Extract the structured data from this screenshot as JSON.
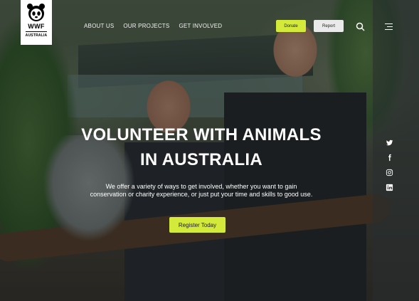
{
  "brand": {
    "logo_text": "WWF",
    "logo_subtext": "AUSTRALIA",
    "icon": "panda-icon"
  },
  "nav": {
    "items": [
      {
        "label": "ABOUT US"
      },
      {
        "label": "OUR PROJECTS"
      },
      {
        "label": "GET INVOLVED"
      }
    ]
  },
  "header_actions": {
    "donate_label": "Donate",
    "report_label": "Report",
    "search_icon": "search-icon",
    "menu_icon": "hamburger-menu-icon"
  },
  "hero": {
    "title_line1": "VOLUNTEER WITH ANIMALS",
    "title_line2": "IN AUSTRALIA",
    "subtitle_line1": "We offer a variety of ways to get involved, whether you want to gain",
    "subtitle_line2": "conservation or charity experience, or just put your time and skills to good use.",
    "cta_label": "Register Today"
  },
  "social": [
    {
      "icon": "twitter-icon"
    },
    {
      "icon": "facebook-icon"
    },
    {
      "icon": "instagram-icon"
    },
    {
      "icon": "linkedin-icon"
    }
  ],
  "colors": {
    "accent": "#d4ea3a",
    "report_button": "#eaeaea",
    "text": "#ffffff"
  }
}
